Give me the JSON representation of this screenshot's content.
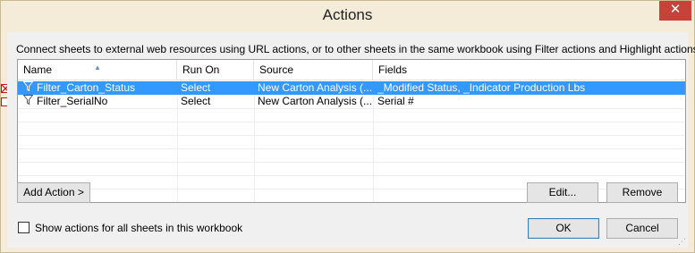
{
  "window": {
    "title": "Actions",
    "close_glyph": "✕"
  },
  "description": "Connect sheets to external web resources using URL actions, or to other sheets in the same workbook using Filter actions and Highlight actions.",
  "table": {
    "columns": [
      "Name",
      "Run On",
      "Source",
      "Fields"
    ],
    "rows": [
      {
        "name": "Filter_Carton_Status",
        "run_on": "Select",
        "source": "New Carton Analysis (...",
        "fields": "_Modified Status, _Indicator Production Lbs",
        "icon": "filter-funnel-icon",
        "selected": true
      },
      {
        "name": "Filter_SerialNo",
        "run_on": "Select",
        "source": "New Carton Analysis (...",
        "fields": "Serial #",
        "icon": "filter-funnel-icon",
        "selected": false
      }
    ]
  },
  "buttons": {
    "add_action": "Add Action >",
    "edit": "Edit...",
    "remove": "Remove",
    "ok": "OK",
    "cancel": "Cancel"
  },
  "show_all_checkbox": {
    "label": "Show actions for all sheets in this workbook",
    "checked": false
  },
  "colors": {
    "selection": "#3399ff",
    "close": "#c7433a",
    "chrome": "#f4ecd9"
  }
}
